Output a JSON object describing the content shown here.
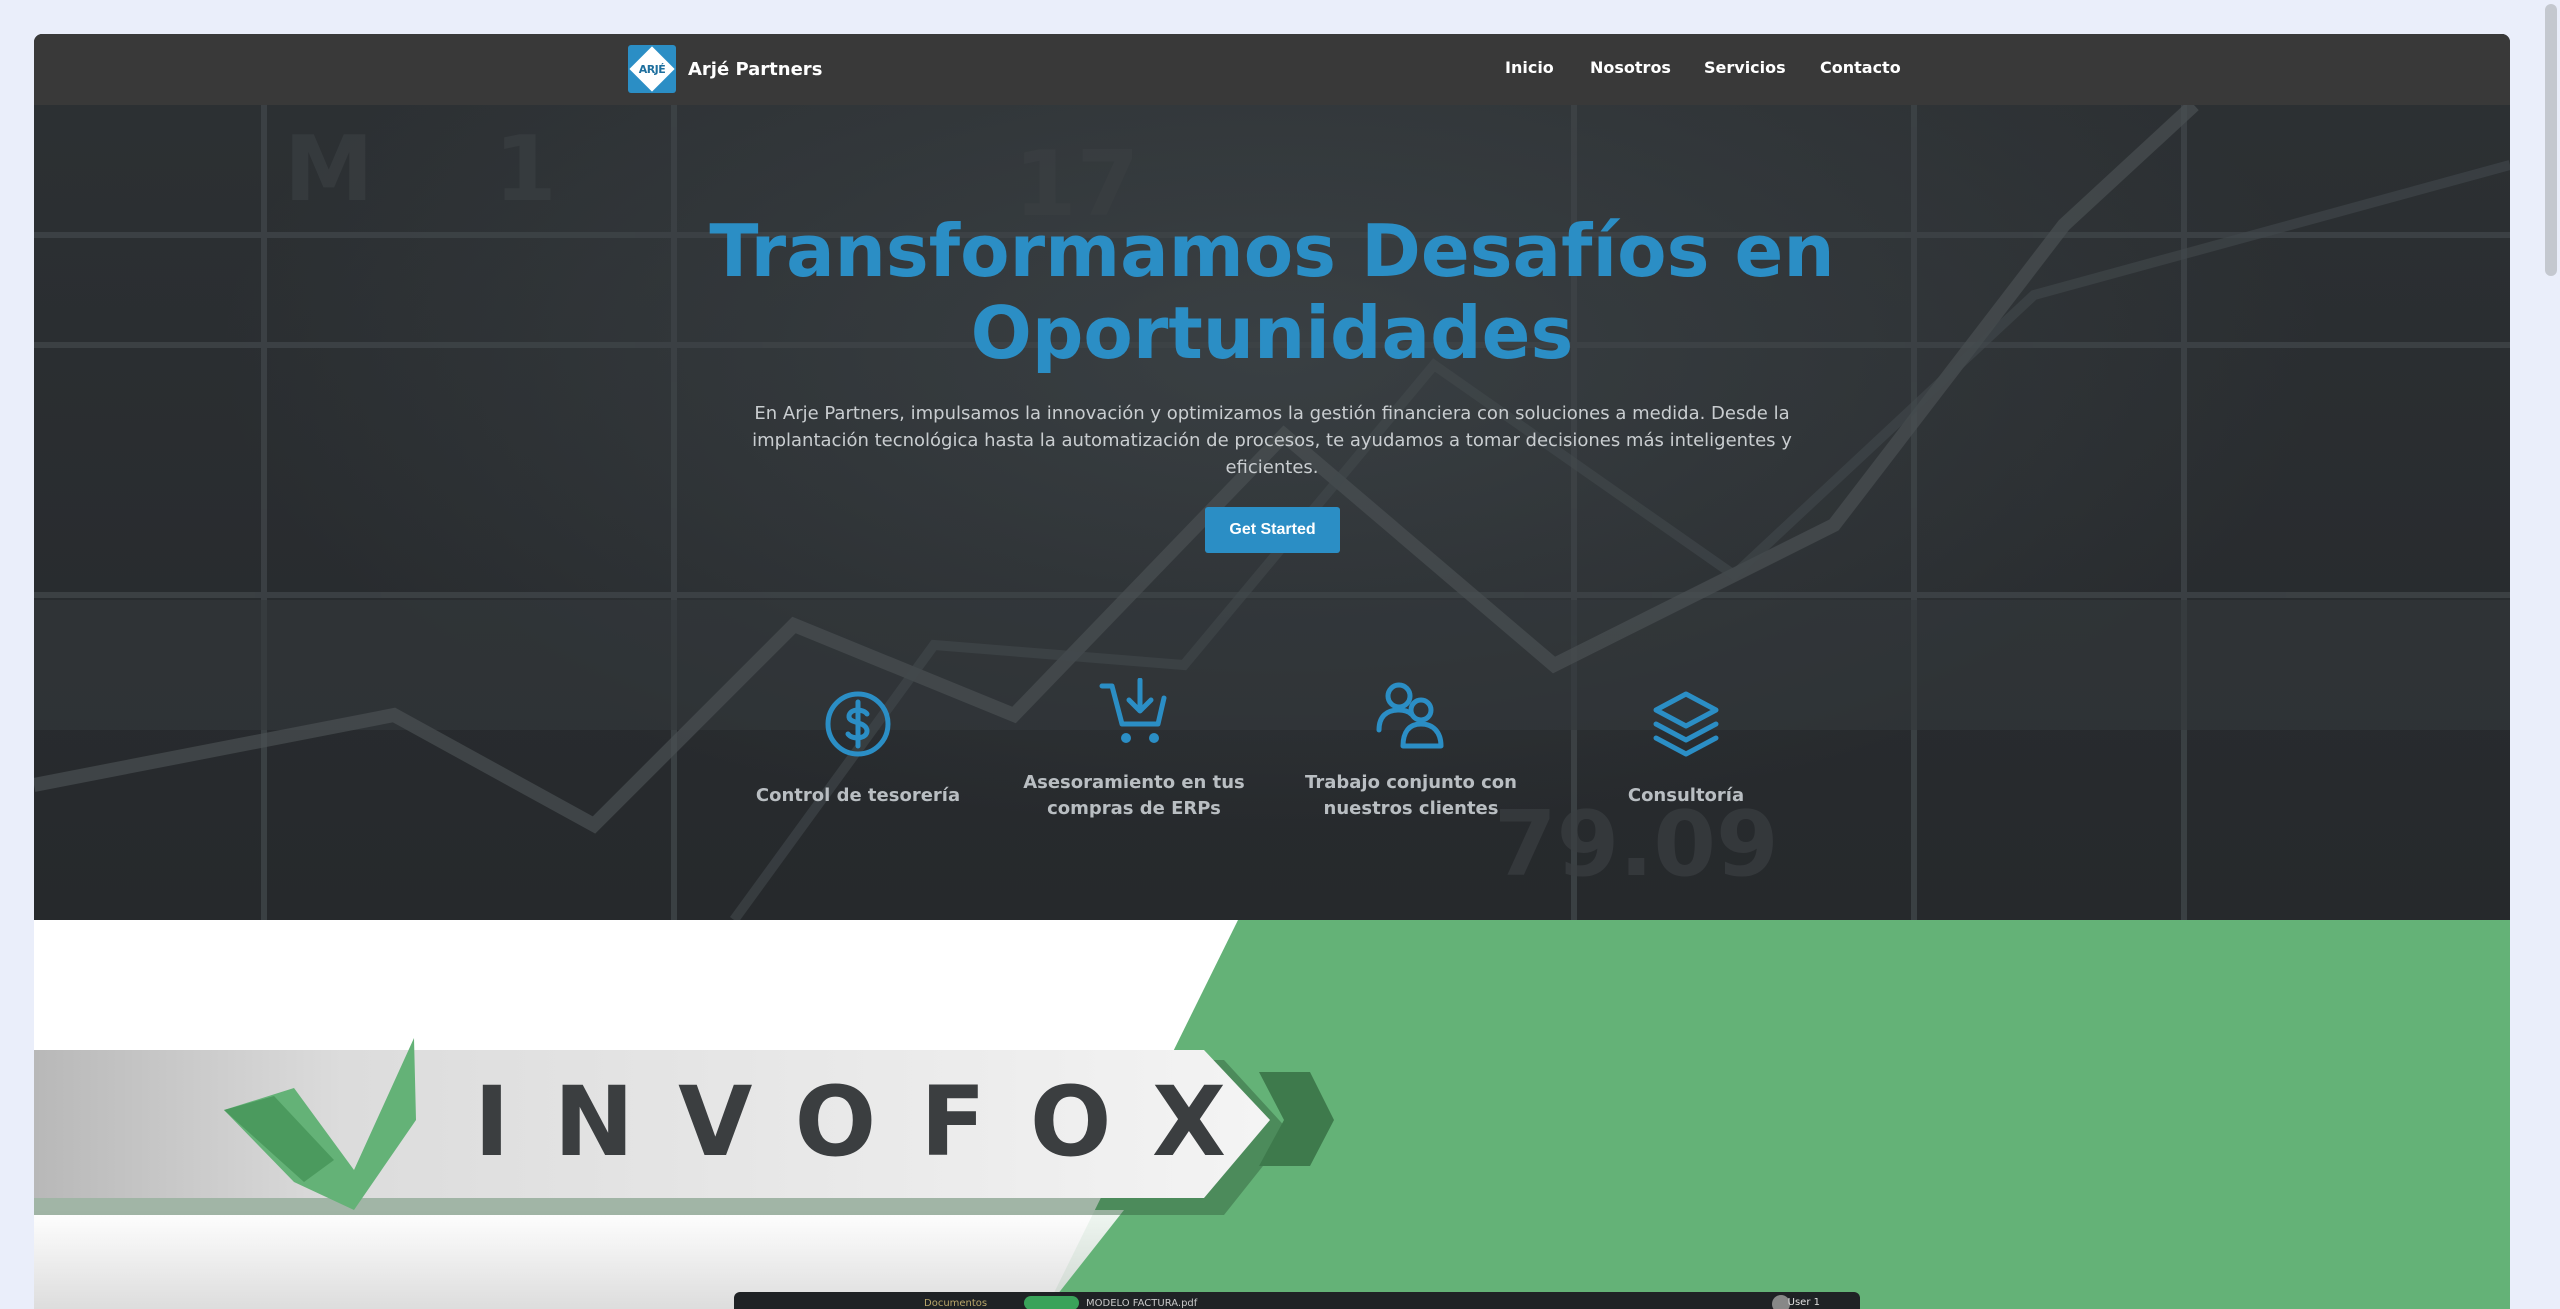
{
  "navbar": {
    "logo_text": "ARJÉ",
    "brand": "Arjé Partners",
    "links": [
      "Inicio",
      "Nosotros",
      "Servicios",
      "Contacto"
    ]
  },
  "hero": {
    "title_line1": "Transformamos Desafíos en",
    "title_line2": "Oportunidades",
    "subtitle": "En Arje Partners, impulsamos la innovación y optimizamos la gestión financiera con soluciones a medida. Desde la implantación tecnológica hasta la automatización de procesos, te ayudamos a tomar decisiones más inteligentes y eficientes.",
    "cta_label": "Get Started",
    "features": [
      {
        "label": "Control de tesorería",
        "icon": "dollar-circle-icon"
      },
      {
        "label": "Asesoramiento en tus compras de ERPs",
        "icon": "cart-download-icon"
      },
      {
        "label": "Trabajo conjunto con nuestros clientes",
        "icon": "people-icon"
      },
      {
        "label": "Consultoría",
        "icon": "layers-icon"
      }
    ]
  },
  "invofox": {
    "wordmark": "INVOFOX",
    "app_breadcrumb": "Documentos",
    "app_document": "MODELO FACTURA.pdf",
    "app_user": "User 1"
  },
  "colors": {
    "accent": "#2b8ec5",
    "navbar_bg": "#393939",
    "hero_bg": "#2a2d2f",
    "invofox_green": "#64b277",
    "invofox_text": "#3b3e40"
  }
}
